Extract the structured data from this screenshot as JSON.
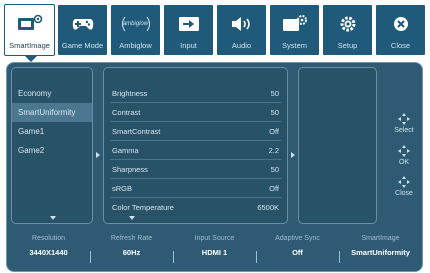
{
  "tabs": [
    {
      "label": "SmartImage",
      "icon": "smartimage-icon",
      "active": true
    },
    {
      "label": "Game Mode",
      "icon": "gamepad-icon",
      "active": false
    },
    {
      "label": "Ambiglow",
      "icon": "ambiglow-icon",
      "active": false
    },
    {
      "label": "Input",
      "icon": "input-icon",
      "active": false
    },
    {
      "label": "Audio",
      "icon": "speaker-icon",
      "active": false
    },
    {
      "label": "System",
      "icon": "system-icon",
      "active": false
    },
    {
      "label": "Setup",
      "icon": "gear-icon",
      "active": false
    },
    {
      "label": "Close",
      "icon": "close-icon",
      "active": false
    }
  ],
  "ambiglow_logo_text": "ambiglow",
  "modes": [
    "Economy",
    "SmartUniformity",
    "Game1",
    "Game2"
  ],
  "selected_mode": "SmartUniformity",
  "settings": [
    {
      "name": "Brightness",
      "value": "50"
    },
    {
      "name": "Contrast",
      "value": "50"
    },
    {
      "name": "SmartContrast",
      "value": "Off"
    },
    {
      "name": "Gamma",
      "value": "2.2"
    },
    {
      "name": "Sharpness",
      "value": "50"
    },
    {
      "name": "sRGB",
      "value": "Off"
    },
    {
      "name": "Color Temperature",
      "value": "6500K"
    }
  ],
  "nav": {
    "select": "Select",
    "ok": "OK",
    "close": "Close"
  },
  "status": [
    {
      "label": "Resolution",
      "value": "3440X1440"
    },
    {
      "label": "Refresh Rate",
      "value": "60Hz"
    },
    {
      "label": "Input Source",
      "value": "HDMI 1"
    },
    {
      "label": "Adaptive Sync",
      "value": "Off"
    },
    {
      "label": "SmartImage",
      "value": "SmartUniformity"
    }
  ],
  "colors": {
    "tab_bg": "#1f5a7a",
    "panel_bg": "#2e5a74",
    "highlight": "#4b7890",
    "text": "#d9e6ee"
  }
}
